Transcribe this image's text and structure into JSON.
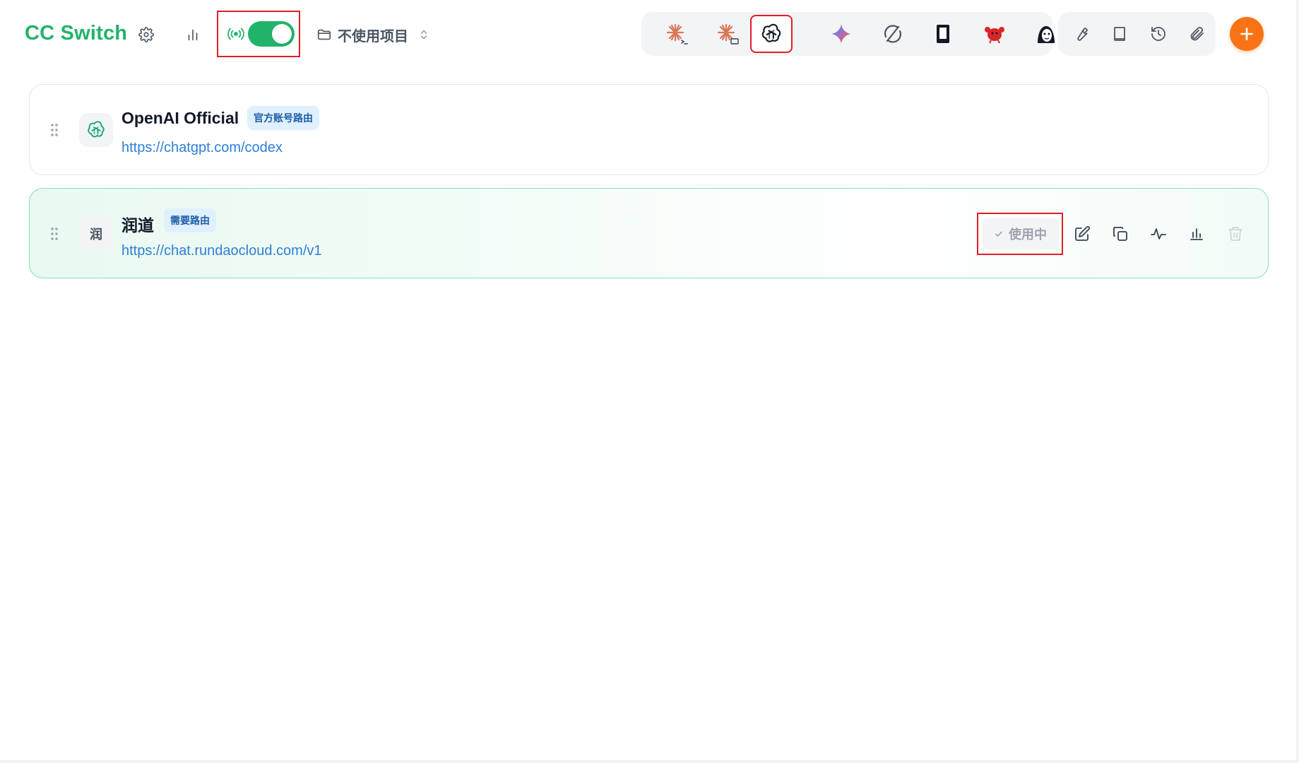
{
  "app": {
    "title": "CC Switch",
    "accent_color": "#22b36b",
    "add_color": "#f97316",
    "highlight_color": "#e11d2a"
  },
  "header": {
    "settings_icon": "gear-icon",
    "stats_icon": "bar-chart-icon",
    "proxy": {
      "icon": "broadcast-icon",
      "enabled": true
    },
    "project": {
      "icon": "folder-icon",
      "label": "不使用项目"
    },
    "apps": [
      {
        "name": "claude-code",
        "icon": "claude-terminal-icon",
        "selected": false
      },
      {
        "name": "claude-desktop",
        "icon": "claude-desktop-icon",
        "selected": false
      },
      {
        "name": "codex",
        "icon": "openai-icon",
        "selected": true
      },
      {
        "name": "gemini",
        "icon": "gemini-sparkle-icon",
        "selected": false
      },
      {
        "name": "opencode",
        "icon": "cycle-icon",
        "selected": false
      },
      {
        "name": "openclaw",
        "icon": "terminal-block-icon",
        "selected": false
      },
      {
        "name": "crab",
        "icon": "red-crab-icon",
        "selected": false
      },
      {
        "name": "mascot",
        "icon": "mascot-face-icon",
        "selected": false
      }
    ],
    "tools": [
      {
        "name": "tools",
        "icon": "wrench-icon"
      },
      {
        "name": "docs",
        "icon": "book-icon"
      },
      {
        "name": "history",
        "icon": "history-icon"
      },
      {
        "name": "attachments",
        "icon": "paperclip-icon"
      }
    ],
    "add_icon": "plus-icon"
  },
  "providers": [
    {
      "name": "OpenAI Official",
      "badge": "官方账号路由",
      "url": "https://chatgpt.com/codex",
      "icon": "openai-icon",
      "active": false
    },
    {
      "name": "润道",
      "initial": "润",
      "badge": "需要路由",
      "url": "https://chat.rundaocloud.com/v1",
      "active": true,
      "status_label": "使用中",
      "actions": [
        "edit-icon",
        "copy-icon",
        "activity-icon",
        "bar-chart-icon",
        "trash-icon"
      ]
    }
  ]
}
